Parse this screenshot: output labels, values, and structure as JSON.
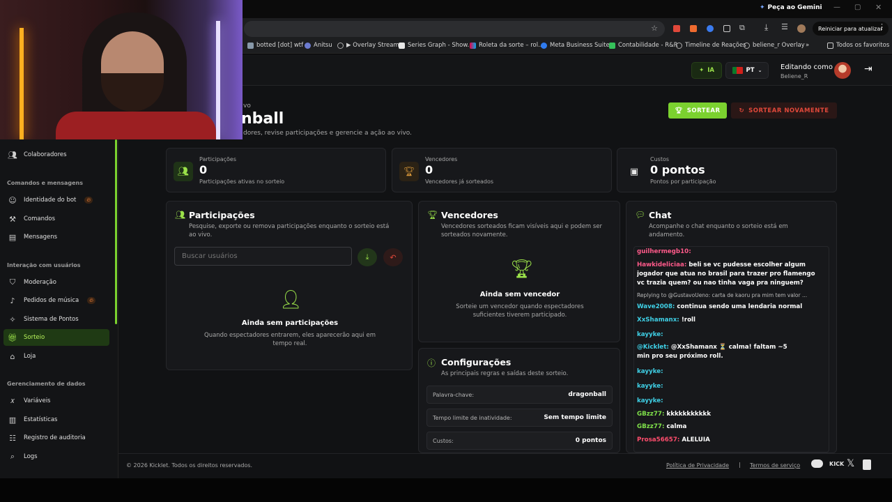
{
  "browser": {
    "gemini_label": "Peça ao Gemini",
    "restart_label": "Reiniciar para atualizar",
    "bookmarks": [
      "botted [dot] wtf",
      "Anitsu",
      "▶ Overlay Stream",
      "Series Graph - Show...",
      "Roleta da sorte – rol...",
      "Meta Business Suite",
      "Contabilidade - R&R",
      "Timeline de Reações",
      "beliene_r Overlay"
    ],
    "all_favorites": "Todos os favoritos",
    "more": "»"
  },
  "topnav": {
    "ia_label": "IA",
    "lang_label": "PT",
    "editing_label": "Editando como",
    "editing_user": "Beliene_R"
  },
  "page": {
    "eyebrow": "vo",
    "title": "nball",
    "subtitle": "dores, revise participações e gerencie a ação ao vivo.",
    "draw_button": "SORTEAR",
    "redraw_button": "SORTEAR NOVAMENTE"
  },
  "sidebar": {
    "collaborators": "Colaboradores",
    "section_commands": "Comandos e mensagens",
    "bot_identity": "Identidade do bot",
    "commands": "Comandos",
    "messages": "Mensagens",
    "section_interaction": "Interação com usuários",
    "moderation": "Moderação",
    "music_requests": "Pedidos de música",
    "points_system": "Sistema de Pontos",
    "raffle": "Sorteio",
    "store": "Loja",
    "section_data": "Gerenciamento de dados",
    "variables": "Variáveis",
    "statistics": "Estatísticas",
    "audit_log": "Registro de auditoria",
    "logs": "Logs"
  },
  "stats": [
    {
      "label": "Participações",
      "value": "0",
      "sub": "Participações ativas no sorteio"
    },
    {
      "label": "Vencedores",
      "value": "0",
      "sub": "Vencedores já sorteados"
    },
    {
      "label": "Custos",
      "value": "0 pontos",
      "sub": "Pontos por participação"
    }
  ],
  "participants": {
    "title": "Participações",
    "desc1": "Pesquise, exporte ou remova participações enquanto o sorteio está",
    "desc2": "ao vivo.",
    "search_placeholder": "Buscar usuários",
    "empty_title": "Ainda sem participações",
    "empty_desc1": "Quando espectadores entrarem, eles aparecerão aqui em",
    "empty_desc2": "tempo real."
  },
  "winners": {
    "title": "Vencedores",
    "desc1": "Vencedores sorteados ficam visíveis aqui e podem ser",
    "desc2": "sorteados novamente.",
    "empty_title": "Ainda sem vencedor",
    "empty_desc1": "Sorteie um vencedor quando espectadores",
    "empty_desc2": "suficientes tiverem participado."
  },
  "config": {
    "title": "Configurações",
    "desc": "As principais regras e saídas deste sorteio.",
    "rows": [
      {
        "key": "Palavra-chave:",
        "value": "dragonball"
      },
      {
        "key": "Tempo limite de inatividade:",
        "value": "Sem tempo limite"
      },
      {
        "key": "Custos:",
        "value": "0 pontos"
      }
    ]
  },
  "chat": {
    "title": "Chat",
    "desc1": "Acompanhe o chat enquanto o sorteio está em",
    "desc2": "andamento.",
    "messages": [
      {
        "user": "guilhermegb10:",
        "text": "",
        "color": "#ff5a8a"
      },
      {
        "user": "Hawkideliciaa:",
        "text": "beli se vc pudesse escolher algum",
        "color": "#ff5a8a"
      },
      {
        "user": "",
        "text": "jogador que atua no brasil para trazer pro flamengo",
        "color": "#ffffff"
      },
      {
        "user": "",
        "text": "vc trazia quem? ou nao tinha vaga pra ninguem?",
        "color": "#ffffff"
      },
      {
        "user": "",
        "text": "Replying to @GustavoUeno: carta de kaoru pra mim tem valor ...",
        "color": "#bbbbbb"
      },
      {
        "user": "Wave2008:",
        "text": "continua sendo uma lendaria normal",
        "color": "#3fd0e6"
      },
      {
        "user": "XxShamanx:",
        "text": "!roll",
        "color": "#3fd0e6"
      },
      {
        "user": "kayyke:",
        "text": "",
        "color": "#3fd0e6"
      },
      {
        "user": "@Kicklet:",
        "text": "@XxShamanx ⏳ calma! faltam ~5",
        "color": "#3fd0e6"
      },
      {
        "user": "",
        "text": "min pro seu próximo roll.",
        "color": "#ffffff"
      },
      {
        "user": "kayyke:",
        "text": "",
        "color": "#3fd0e6"
      },
      {
        "user": "kayyke:",
        "text": "",
        "color": "#3fd0e6"
      },
      {
        "user": "kayyke:",
        "text": "",
        "color": "#3fd0e6"
      },
      {
        "user": "GBzz77:",
        "text": "kkkkkkkkkkk",
        "color": "#7fe04a"
      },
      {
        "user": "GBzz77:",
        "text": "calma",
        "color": "#7fe04a"
      },
      {
        "user": "Prosa56657:",
        "text": "ALELUIA",
        "color": "#ff4d6d"
      }
    ]
  },
  "footer": {
    "copyright": "© 2026 Kicklet. Todos os direitos reservados.",
    "privacy": "Política de Privacidade",
    "separator": "|",
    "terms": "Termos de serviço",
    "kick": "KICK"
  },
  "colors": {
    "accent": "#7bd12f",
    "danger": "#e0483a",
    "bg": "#111214"
  }
}
